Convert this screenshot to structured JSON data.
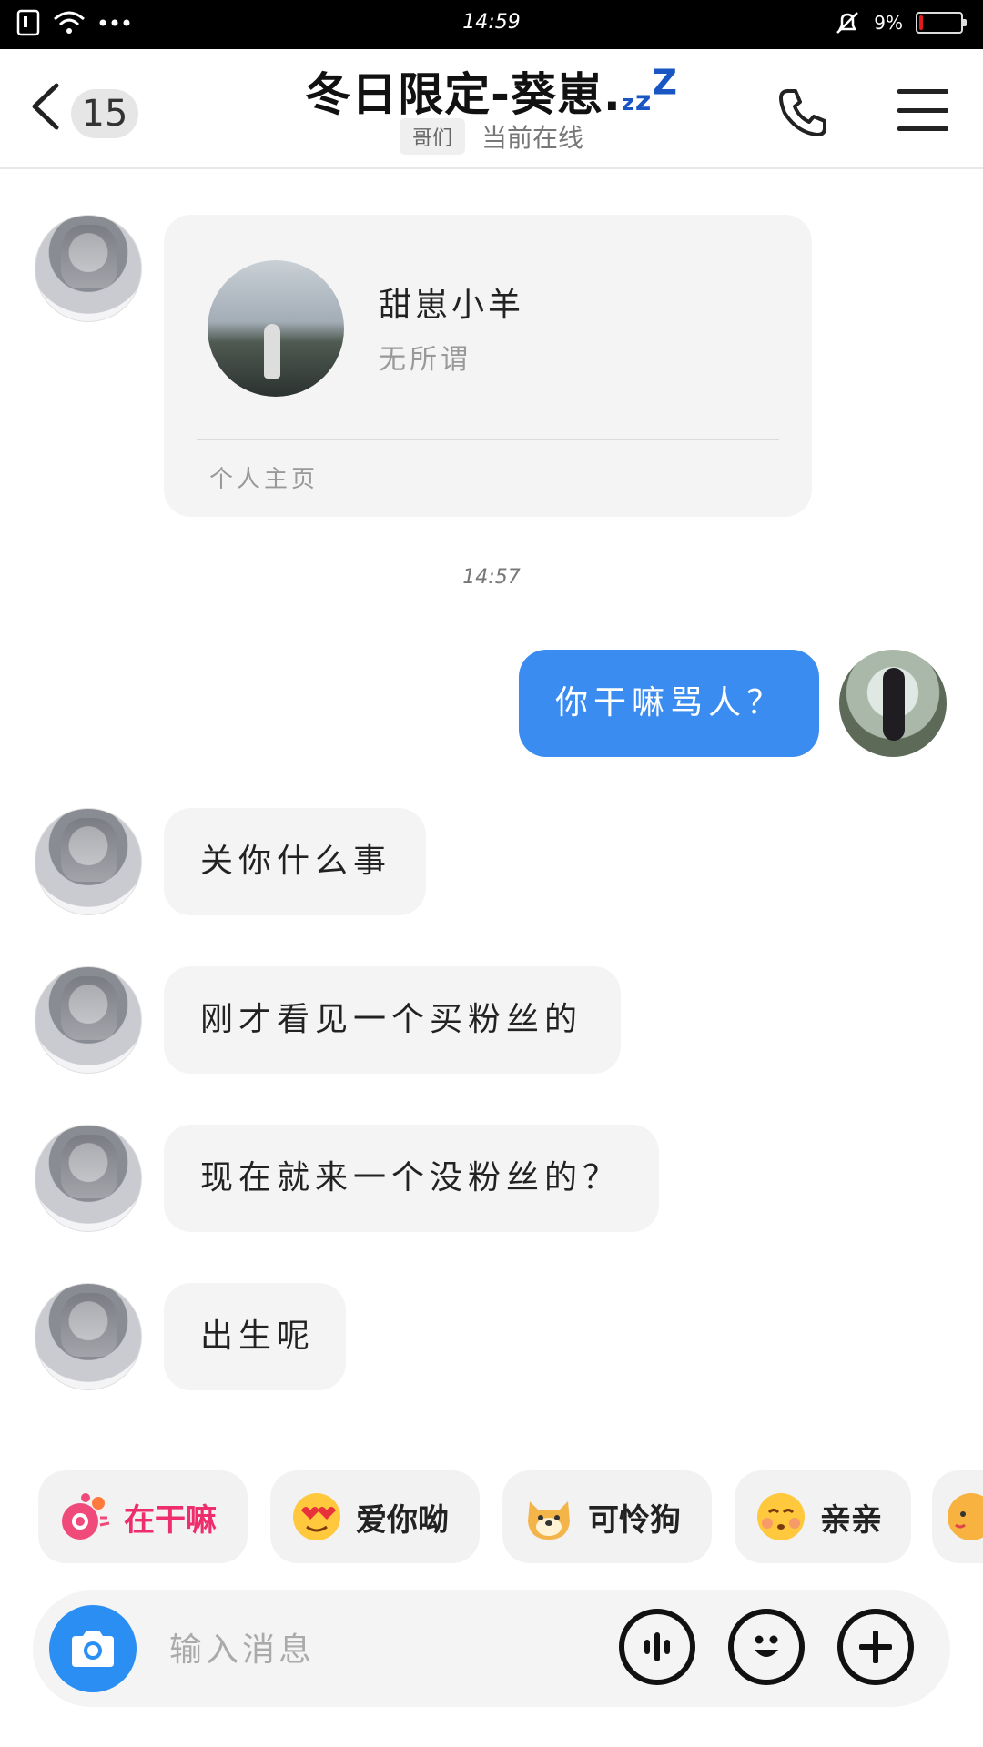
{
  "status_bar": {
    "time": "14:59",
    "battery": "9%",
    "battery_level": 0.09
  },
  "header": {
    "unread_count": "15",
    "title": "冬日限定-葵崽.",
    "title_suffix": [
      "z",
      "z",
      "Z"
    ],
    "relation_tag": "哥们",
    "status": "当前在线"
  },
  "card": {
    "name": "甜崽小羊",
    "signature": "无所谓",
    "link_label": "个人主页"
  },
  "chat": {
    "timestamp": "14:57",
    "sent": [
      {
        "text": "你干嘛骂人？"
      }
    ],
    "received": [
      {
        "text": "关你什么事"
      },
      {
        "text": "刚才看见一个买粉丝的"
      },
      {
        "text": "现在就来一个没粉丝的？"
      },
      {
        "text": "出生呢"
      }
    ]
  },
  "quick_replies": [
    {
      "label": "在干嘛",
      "icon": "camera-bubbles-icon",
      "color": "#ee2e6c"
    },
    {
      "label": "爱你呦",
      "icon": "heart-eyes-emoji-icon"
    },
    {
      "label": "可怜狗",
      "icon": "doge-emoji-icon"
    },
    {
      "label": "亲亲",
      "icon": "kiss-emoji-icon"
    }
  ],
  "composer": {
    "placeholder": "输入消息"
  },
  "colors": {
    "accent": "#3b8cf0",
    "camera": "#2b8ef2",
    "hot": "#ee2e6c",
    "title_zzz": "#1a55c4"
  }
}
